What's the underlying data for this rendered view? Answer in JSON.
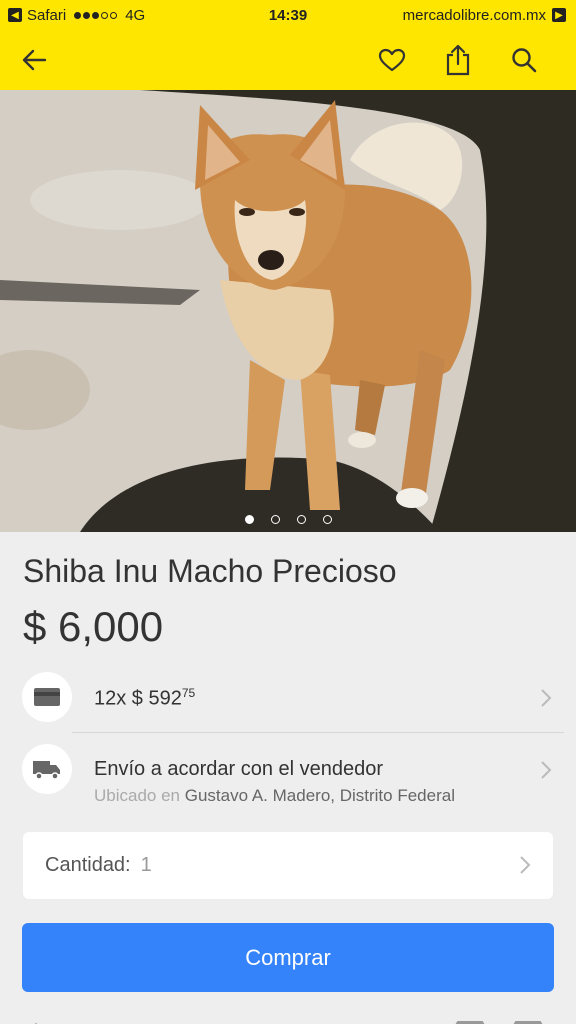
{
  "status_bar": {
    "back_app": "Safari",
    "network": "4G",
    "time": "14:39",
    "url": "mercadolibre.com.mx"
  },
  "nav": {
    "back_icon": "arrow-left-icon",
    "favorite_icon": "heart-icon",
    "share_icon": "share-icon",
    "search_icon": "search-icon"
  },
  "gallery": {
    "photo_description_icon": "dog-photo",
    "page_count": 4,
    "active_page": 1
  },
  "product": {
    "title": "Shiba Inu Macho Precioso",
    "price": "$ 6,000"
  },
  "installments": {
    "prefix": "12x $ 592",
    "cents": "75",
    "icon": "credit-card-icon"
  },
  "shipping": {
    "label": "Envío a acordar con el vendedor",
    "location_prefix": "Ubicado en",
    "location": "Gustavo A. Madero, Distrito Federal",
    "icon": "truck-icon"
  },
  "quantity": {
    "label": "Cantidad:",
    "value": "1"
  },
  "buy_button": {
    "label": "Comprar"
  },
  "colors": {
    "brand_yellow": "#ffe600",
    "buy_blue": "#3483fa",
    "background": "#eeeeee"
  }
}
